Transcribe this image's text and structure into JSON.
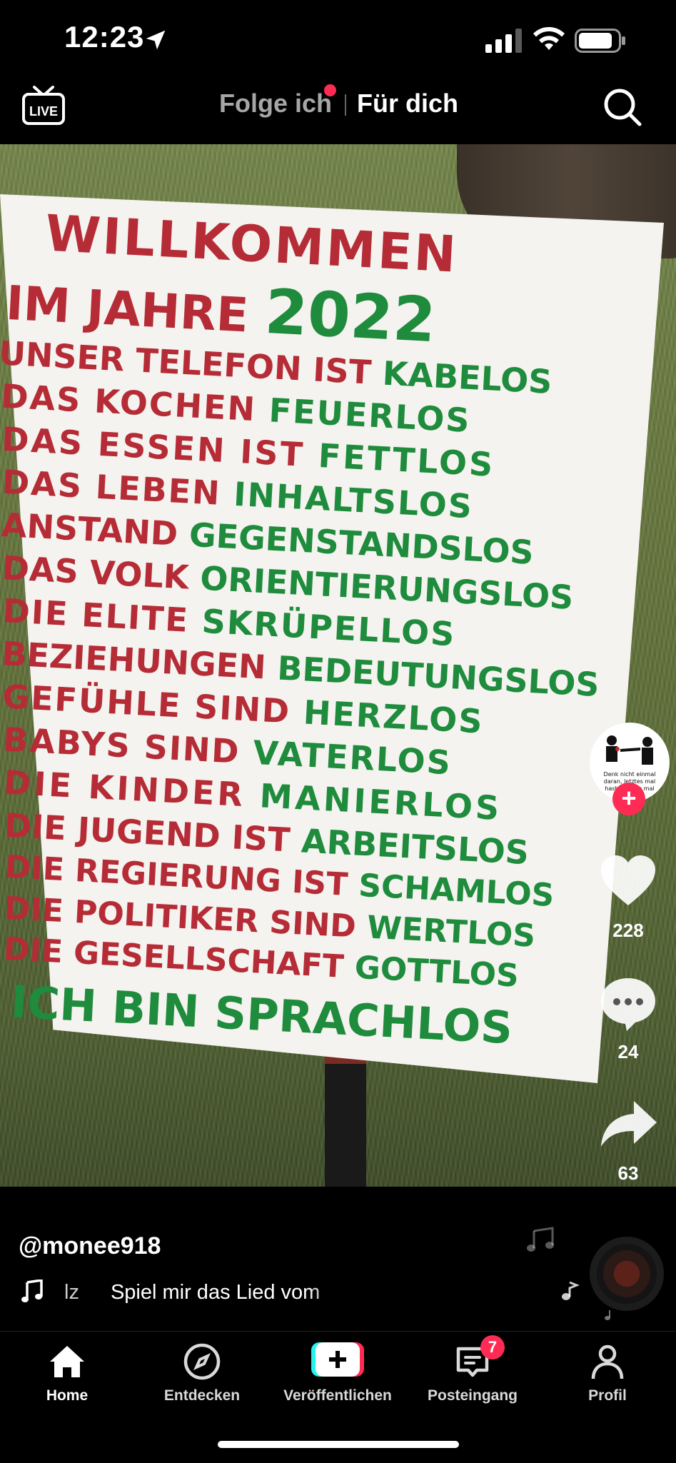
{
  "status_bar": {
    "time": "12:23"
  },
  "top_nav": {
    "live_label": "LIVE",
    "tabs": [
      {
        "label": "Folge ich",
        "active": false,
        "has_dot": true
      },
      {
        "label": "Für dich",
        "active": true
      }
    ]
  },
  "video": {
    "sign_lines": [
      {
        "text": "WILLKOMMEN"
      },
      {
        "text_red": "IM JAHRE",
        "text_green": "2022"
      },
      {
        "text_red": "UNSER TELEFON IST",
        "text_green": "KABELOS"
      },
      {
        "text_red": "DAS KOCHEN",
        "text_green": "FEUERLOS"
      },
      {
        "text_red": "DAS ESSEN IST",
        "text_green": "FETTLOS"
      },
      {
        "text_red": "DAS LEBEN",
        "text_green": "INHALTSLOS"
      },
      {
        "text_red": "ANSTAND",
        "text_green": "GEGENSTANDSLOS"
      },
      {
        "text_red": "DAS VOLK",
        "text_green": "ORIENTIERUNGSLOS"
      },
      {
        "text_red": "DIE ELITE",
        "text_green": "SKRÜPELLOS"
      },
      {
        "text_red": "BEZIEHUNGEN",
        "text_green": "BEDEUTUNGSLOS"
      },
      {
        "text_red": "GEFÜHLE SIND",
        "text_green": "HERZLOS"
      },
      {
        "text_red": "BABYS SIND",
        "text_green": "VATERLOS"
      },
      {
        "text_red": "DIE KINDER",
        "text_green": "MANIERLOS"
      },
      {
        "text_red": "DIE JUGEND IST",
        "text_green": "ARBEITSLOS"
      },
      {
        "text_red": "DIE REGIERUNG IST",
        "text_green": "SCHAMLOS"
      },
      {
        "text_red": "DIE POLITIKER SIND",
        "text_green": "WERTLOS"
      },
      {
        "text_red": "DIE GESELLSCHAFT",
        "text_green": "GOTTLOS"
      },
      {
        "text": "ICH BIN SPRACHLOS"
      }
    ],
    "sign_colors": {
      "red": "#b52c36",
      "green": "#1f8b3c"
    }
  },
  "actions": {
    "avatar_caption": "Denk nicht einmal daran, letztes mal hast du mich mal",
    "likes": "228",
    "comments": "24",
    "shares": "63"
  },
  "caption": {
    "username": "@monee918",
    "sound_prefix": "lz",
    "sound_title": "Spiel mir das Lied vom"
  },
  "bottom_nav": {
    "items": [
      {
        "label": "Home",
        "icon": "home-icon",
        "active": true
      },
      {
        "label": "Entdecken",
        "icon": "compass-icon",
        "active": false
      },
      {
        "label": "Veröffentlichen",
        "icon": "create-plus-icon",
        "active": false
      },
      {
        "label": "Posteingang",
        "icon": "inbox-icon",
        "active": false,
        "badge": "7"
      },
      {
        "label": "Profil",
        "icon": "profile-icon",
        "active": false
      }
    ]
  },
  "colors": {
    "accent": "#fe2c55",
    "background": "#000000"
  }
}
